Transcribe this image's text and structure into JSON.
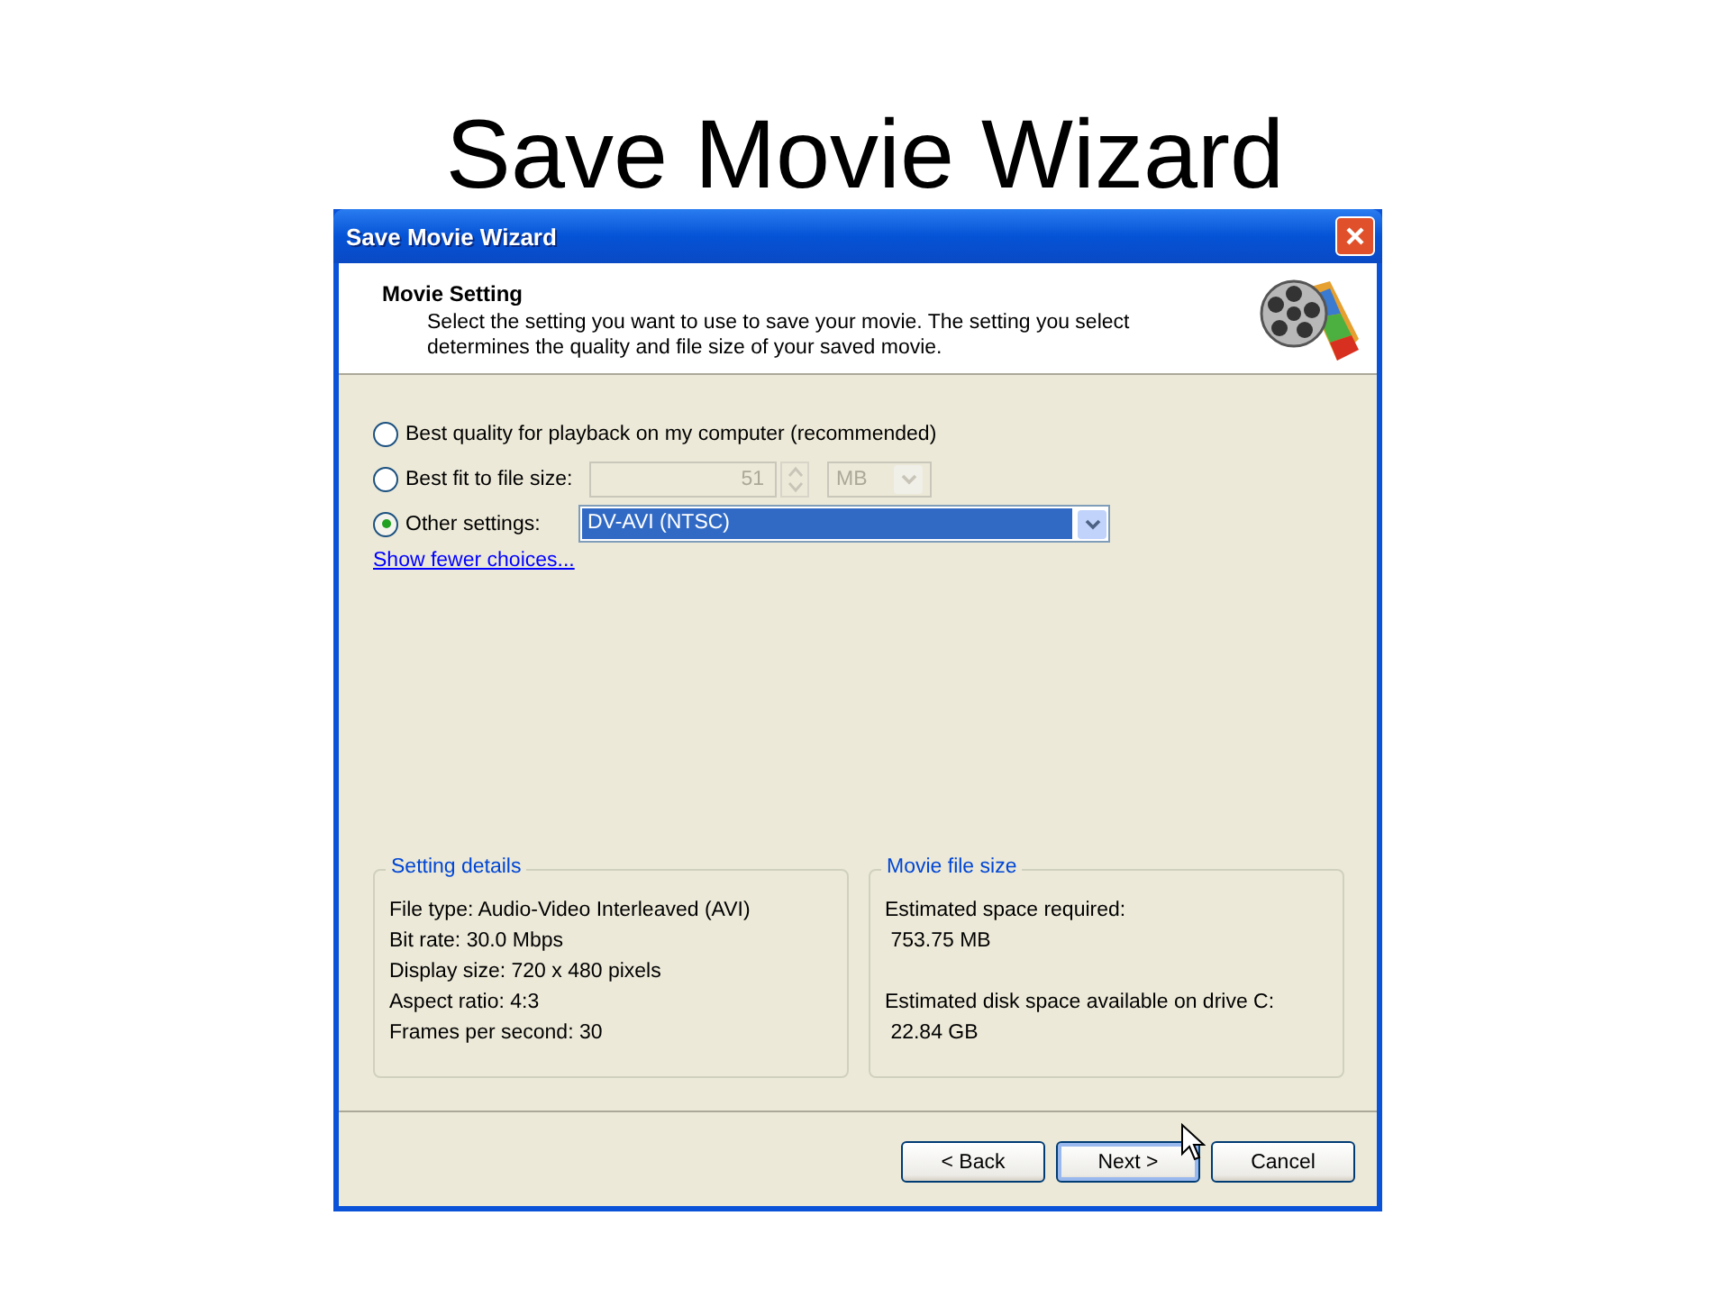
{
  "slide_title": "Save Movie Wizard",
  "window": {
    "title": "Save Movie Wizard"
  },
  "header": {
    "heading": "Movie Setting",
    "description": "Select the setting you want to use to save your movie. The setting you select determines the quality and file size of your saved movie."
  },
  "options": [
    {
      "kind": "plain",
      "label": "Best quality for playback on my computer (recommended)",
      "selected": false
    },
    {
      "kind": "size",
      "label": "Best fit to file size:",
      "selected": false,
      "value": "51",
      "unit": "MB",
      "disabled": true
    },
    {
      "kind": "dropdown",
      "label": "Other settings:",
      "selected": true,
      "value": "DV-AVI (NTSC)"
    }
  ],
  "link": "Show fewer choices...",
  "groups": [
    {
      "title": "Setting details",
      "blocks": [
        [
          "File type: Audio-Video Interleaved (AVI)",
          "Bit rate: 30.0 Mbps",
          "Display size: 720 x 480 pixels",
          "Aspect ratio: 4:3",
          "Frames per second: 30"
        ]
      ]
    },
    {
      "title": "Movie file size",
      "blocks": [
        [
          "Estimated space required:",
          " 753.75 MB"
        ],
        [
          "Estimated disk space available on drive C:",
          " 22.84 GB"
        ]
      ]
    }
  ],
  "buttons": [
    {
      "label": "< Back",
      "default": false
    },
    {
      "label": "Next >",
      "default": true
    },
    {
      "label": "Cancel",
      "default": false
    }
  ]
}
